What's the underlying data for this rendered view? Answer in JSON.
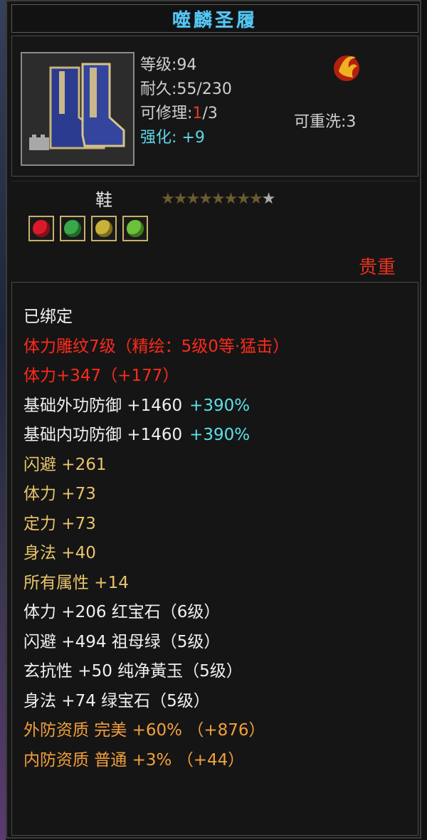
{
  "window": {
    "title": "噬麟圣履"
  },
  "item": {
    "level": "等级:94",
    "durability": "耐久:55/230",
    "repair_label": "可修理:",
    "repair_used": "1",
    "repair_max": "/3",
    "rewash": "可重洗:3",
    "strengthen": "强化: +9",
    "type": "鞋",
    "stars": "★★★★★★★★",
    "last_star": "★",
    "rarity": "贵重",
    "gems": [
      {
        "color": "#d81b2a"
      },
      {
        "color": "#3aa84a"
      },
      {
        "color": "#c9b13a"
      },
      {
        "color": "#6cc23a"
      }
    ]
  },
  "attributes": {
    "bound": "已绑定",
    "engrave": "体力雕纹7级（精绘：5级0等·猛击）",
    "stamina_bonus": "体力+347（+177）",
    "ext_def_label": "基础外功防御 +1460",
    "ext_def_pct": "+390%",
    "int_def_label": "基础内功防御 +1460",
    "int_def_pct": "+390%",
    "dodge": "闪避 +261",
    "stamina": "体力 +73",
    "focus": "定力 +73",
    "agility": "身法 +40",
    "all_attr": "所有属性 +14",
    "gem_stamina": "体力 +206 红宝石（6级）",
    "gem_dodge": "闪避 +494 祖母绿（5级）",
    "gem_resist": "玄抗性 +50 纯净黃玉（5级）",
    "gem_agility": "身法 +74 绿宝石（5级）",
    "ext_quality": "外防资质 完美 +60% （+876）",
    "int_quality": "内防资质 普通 +3% （+44）"
  }
}
